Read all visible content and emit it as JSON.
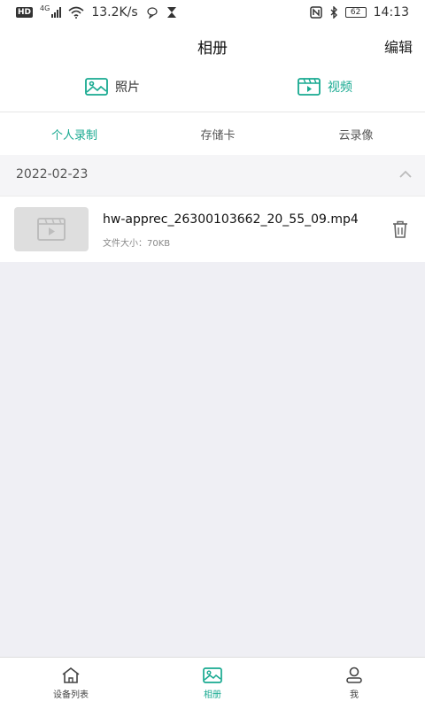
{
  "statusbar": {
    "hd": "HD",
    "network": "4G",
    "speed": "13.2K/s",
    "battery": "62",
    "time": "14:13"
  },
  "header": {
    "title": "相册",
    "edit_label": "编辑"
  },
  "media_tabs": [
    {
      "label": "照片",
      "icon": "image-icon",
      "active": false
    },
    {
      "label": "视频",
      "icon": "video-icon",
      "active": true
    }
  ],
  "sub_tabs": [
    {
      "label": "个人录制",
      "active": true
    },
    {
      "label": "存储卡",
      "active": false
    },
    {
      "label": "云录像",
      "active": false
    }
  ],
  "group": {
    "date": "2022-02-23",
    "expanded": true
  },
  "files": [
    {
      "name": "hw-apprec_26300103662_20_55_09.mp4",
      "size_text": "文件大小：70KB"
    }
  ],
  "bottom_nav": [
    {
      "label": "设备列表",
      "icon": "home-icon",
      "active": false
    },
    {
      "label": "相册",
      "icon": "image-icon",
      "active": true
    },
    {
      "label": "我",
      "icon": "user-icon",
      "active": false
    }
  ],
  "colors": {
    "accent": "#17a990",
    "background": "#efeff4"
  }
}
